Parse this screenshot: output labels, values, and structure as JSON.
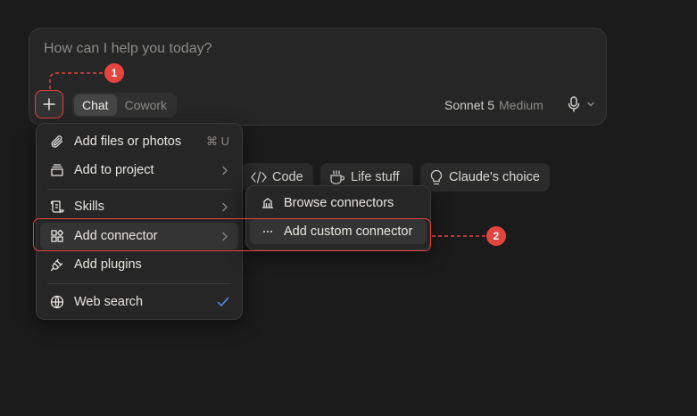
{
  "composer": {
    "placeholder": "How can I help you today?",
    "modes": [
      {
        "label": "Chat",
        "active": true
      },
      {
        "label": "Cowork",
        "active": false
      }
    ],
    "model": "Sonnet 5",
    "effort": "Medium"
  },
  "chips": [
    {
      "label": "Code",
      "icon": "code-icon"
    },
    {
      "label": "Life stuff",
      "icon": "coffee-cup-icon"
    },
    {
      "label": "Claude's choice",
      "icon": "lightbulb-icon"
    }
  ],
  "menu": {
    "items": [
      {
        "label": "Add files or photos",
        "icon": "paperclip-icon",
        "shortcut": "⌘ U"
      },
      {
        "label": "Add to project",
        "icon": "project-box-icon",
        "has_submenu": true
      },
      {
        "label": "Skills",
        "icon": "scroll-icon",
        "has_submenu": true
      },
      {
        "label": "Add connector",
        "icon": "connector-grid-icon",
        "has_submenu": true,
        "highlighted": true
      },
      {
        "label": "Add plugins",
        "icon": "plug-icon"
      },
      {
        "label": "Web search",
        "icon": "globe-icon",
        "checked": true
      }
    ]
  },
  "submenu": {
    "items": [
      {
        "label": "Browse connectors",
        "icon": "building-icon"
      },
      {
        "label": "Add custom connector",
        "icon": "ellipsis-icon",
        "highlighted": true
      }
    ]
  },
  "annotations": {
    "step1": "1",
    "step2": "2"
  },
  "colors": {
    "accent_red": "#e2453f",
    "check_blue": "#5a8dee",
    "background": "#1b1b1b"
  }
}
